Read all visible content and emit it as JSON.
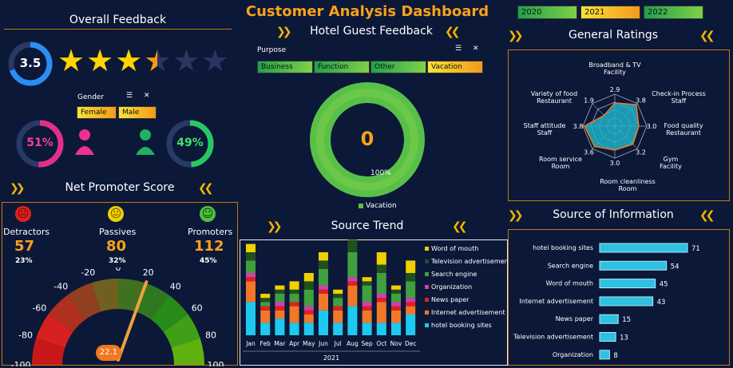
{
  "title": "Customer Analysis Dashboard",
  "subtitle": "Hotel Guest Feedback",
  "years": [
    {
      "label": "2020",
      "selected": false
    },
    {
      "label": "2021",
      "selected": true
    },
    {
      "label": "2022",
      "selected": false
    }
  ],
  "overall": {
    "title": "Overall Feedback",
    "score": "3.5",
    "stars": 3.5,
    "gender_label": "Gender",
    "female": "Female",
    "male": "Male",
    "female_pct": "51%",
    "male_pct": "49%",
    "female_frac": 0.51,
    "male_frac": 0.49
  },
  "nps": {
    "title": "Net Promoter Score",
    "detractors": "Detractors",
    "passives": "Passives",
    "promoters": "Promoters",
    "det_val": "57",
    "pas_val": "80",
    "pro_val": "112",
    "det_pct": "23%",
    "pas_pct": "32%",
    "pro_pct": "45%",
    "gauge_value": "22.1",
    "gauge_num": 22.1,
    "ticks": [
      "-100",
      "-80",
      "-60",
      "-40",
      "-20",
      "0",
      "20",
      "40",
      "60",
      "80",
      "100"
    ]
  },
  "purpose": {
    "label": "Purpose",
    "items": [
      {
        "label": "Business",
        "selected": false
      },
      {
        "label": "Function",
        "selected": false
      },
      {
        "label": "Other",
        "selected": false
      },
      {
        "label": "Vacation",
        "selected": true
      }
    ],
    "donut_center": "0",
    "donut_label": "100%",
    "legend": "Vacation"
  },
  "trend": {
    "title": "Source Trend",
    "year": "2021"
  },
  "ratings": {
    "title": "General Ratings",
    "labels": [
      "Broadband & TV Facility",
      "Check-in Process Staff",
      "Food quality Restaurant",
      "Gym Facility",
      "Room cleanliness Room",
      "Room service Room",
      "Staff attitude Staff",
      "Variety of food Restaurant"
    ],
    "values": [
      "2.9",
      "3.8",
      "3.0",
      "3.2",
      "3.0",
      "3.6",
      "3.8",
      "1.9"
    ],
    "nums": [
      2.9,
      3.8,
      3.0,
      3.2,
      3.0,
      3.6,
      3.8,
      1.9
    ]
  },
  "source": {
    "title": "Source of Information"
  },
  "chart_data": [
    {
      "type": "bar",
      "title": "Source of Information",
      "categories": [
        "hotel booking sites",
        "Search engine",
        "Word of mouth",
        "Internet advertisement",
        "News paper",
        "Television advertisement",
        "Organization"
      ],
      "values": [
        71,
        54,
        45,
        43,
        15,
        13,
        8
      ]
    },
    {
      "type": "bar",
      "title": "Source Trend",
      "stacked": true,
      "categories": [
        "Jan",
        "Feb",
        "Mar",
        "Apr",
        "May",
        "Jun",
        "Jul",
        "Aug",
        "Sep",
        "Oct",
        "Nov",
        "Dec"
      ],
      "xlabel": "2021",
      "series": [
        {
          "name": "hotel booking sites",
          "color": "#1ec8f0",
          "values": [
            8,
            3,
            4,
            3,
            3,
            6,
            3,
            7,
            3,
            3,
            3,
            5
          ]
        },
        {
          "name": "Internet advertisement",
          "color": "#f07828",
          "values": [
            5,
            3,
            2,
            4,
            2,
            4,
            3,
            5,
            3,
            5,
            3,
            2
          ]
        },
        {
          "name": "News paper",
          "color": "#e02020",
          "values": [
            1,
            1,
            1,
            1,
            1,
            1,
            1,
            1,
            1,
            1,
            1,
            1
          ]
        },
        {
          "name": "Organization",
          "color": "#d040b0",
          "values": [
            1,
            0,
            1,
            0,
            1,
            1,
            0,
            1,
            1,
            1,
            1,
            1
          ]
        },
        {
          "name": "Search engine",
          "color": "#40a040",
          "values": [
            3,
            1,
            2,
            2,
            4,
            4,
            2,
            6,
            4,
            5,
            2,
            4
          ]
        },
        {
          "name": "Television advertisement",
          "color": "#205020",
          "values": [
            2,
            1,
            1,
            1,
            2,
            2,
            1,
            3,
            1,
            2,
            1,
            2
          ]
        },
        {
          "name": "Word of mouth",
          "color": "#f0d000",
          "values": [
            2,
            1,
            1,
            2,
            2,
            2,
            1,
            2,
            1,
            3,
            1,
            3
          ]
        }
      ]
    }
  ]
}
